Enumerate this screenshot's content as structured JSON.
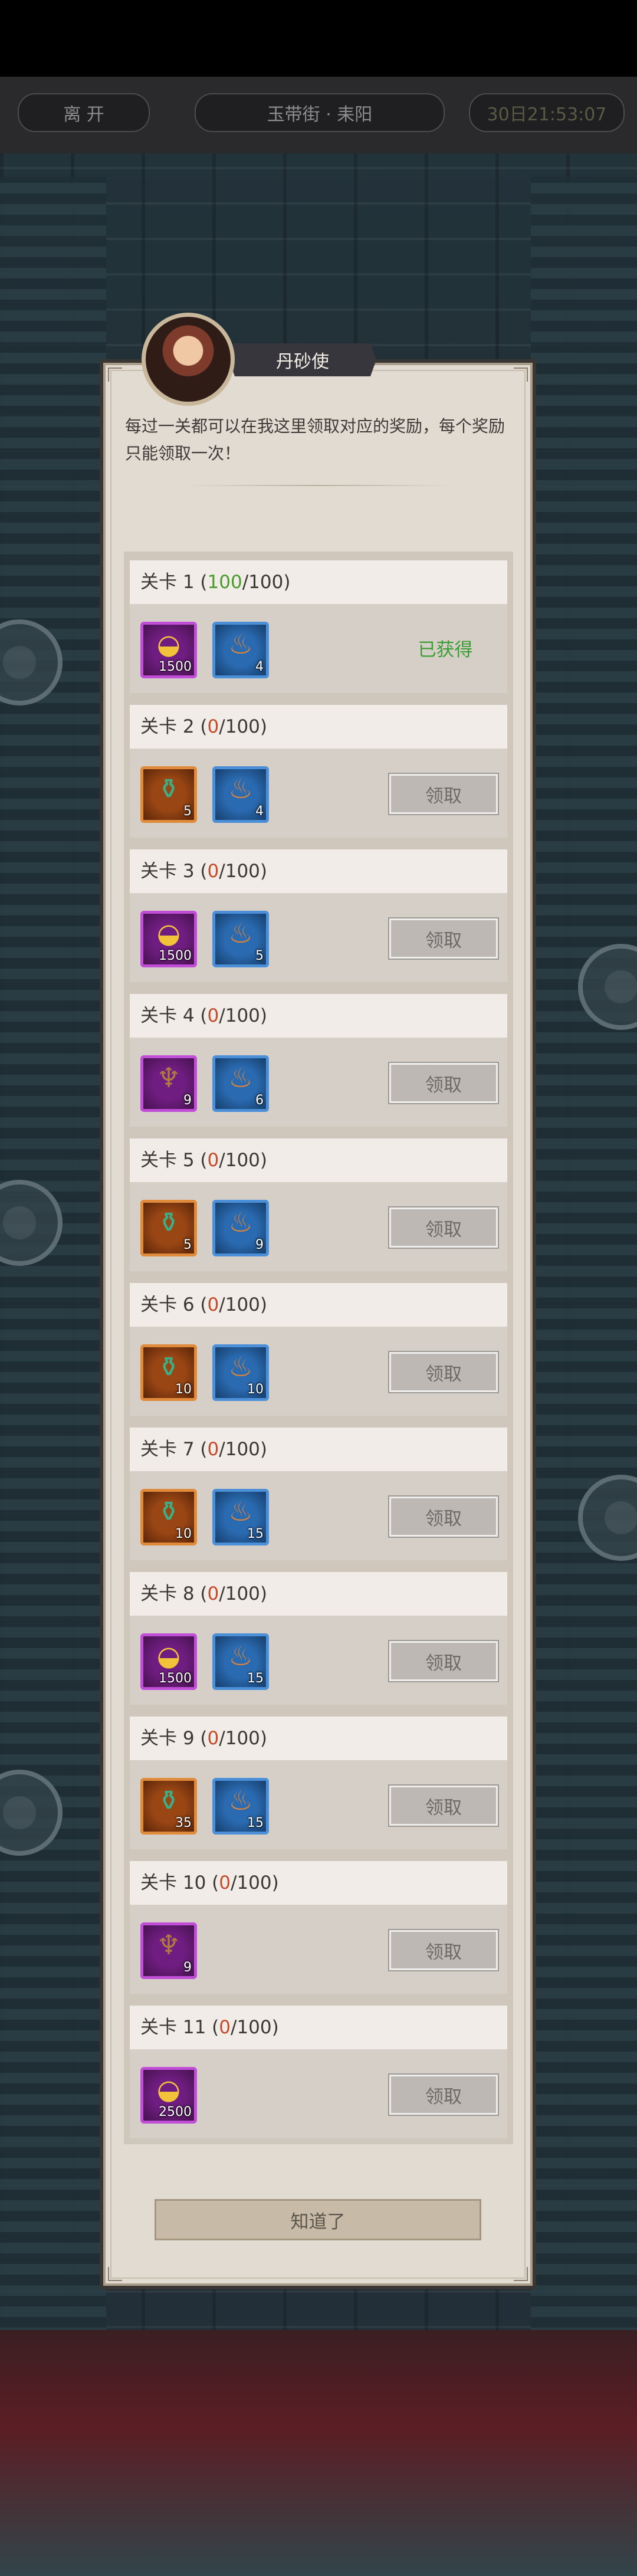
{
  "header": {
    "leave_label": "离 开",
    "location_label": "玉带街 · 耒阳",
    "timer_label": "30日21:53:07"
  },
  "npc": {
    "name": "丹砂使",
    "message": "每过一关都可以在我这里领取对应的奖励，每个奖励只能领取一次！"
  },
  "levels": [
    {
      "label": "关卡 1",
      "progress": "100",
      "total": "100",
      "status": "已获得",
      "rewards": [
        {
          "icon": "gold-ingot-icon",
          "color": "purple",
          "qty": "1500"
        },
        {
          "icon": "pouch-icon",
          "color": "blue",
          "qty": "4"
        }
      ]
    },
    {
      "label": "关卡 2",
      "progress": "0",
      "total": "100",
      "status": "领取",
      "rewards": [
        {
          "icon": "gourd-icon",
          "color": "orange",
          "qty": "5"
        },
        {
          "icon": "pouch-icon",
          "color": "blue",
          "qty": "4"
        }
      ]
    },
    {
      "label": "关卡 3",
      "progress": "0",
      "total": "100",
      "status": "领取",
      "rewards": [
        {
          "icon": "gold-ingot-icon",
          "color": "purple",
          "qty": "1500"
        },
        {
          "icon": "pouch-icon",
          "color": "blue",
          "qty": "5"
        }
      ]
    },
    {
      "label": "关卡 4",
      "progress": "0",
      "total": "100",
      "status": "领取",
      "rewards": [
        {
          "icon": "incense-burner-icon",
          "color": "purple",
          "qty": "9"
        },
        {
          "icon": "pouch-icon",
          "color": "blue",
          "qty": "6"
        }
      ]
    },
    {
      "label": "关卡 5",
      "progress": "0",
      "total": "100",
      "status": "领取",
      "rewards": [
        {
          "icon": "gourd-icon",
          "color": "orange",
          "qty": "5"
        },
        {
          "icon": "pouch-icon",
          "color": "blue",
          "qty": "9"
        }
      ]
    },
    {
      "label": "关卡 6",
      "progress": "0",
      "total": "100",
      "status": "领取",
      "rewards": [
        {
          "icon": "gourd-icon",
          "color": "orange",
          "qty": "10"
        },
        {
          "icon": "pouch-icon",
          "color": "blue",
          "qty": "10"
        }
      ]
    },
    {
      "label": "关卡 7",
      "progress": "0",
      "total": "100",
      "status": "领取",
      "rewards": [
        {
          "icon": "gourd-icon",
          "color": "orange",
          "qty": "10"
        },
        {
          "icon": "pouch-icon",
          "color": "blue",
          "qty": "15"
        }
      ]
    },
    {
      "label": "关卡 8",
      "progress": "0",
      "total": "100",
      "status": "领取",
      "rewards": [
        {
          "icon": "gold-ingot-icon",
          "color": "purple",
          "qty": "1500"
        },
        {
          "icon": "pouch-icon",
          "color": "blue",
          "qty": "15"
        }
      ]
    },
    {
      "label": "关卡 9",
      "progress": "0",
      "total": "100",
      "status": "领取",
      "rewards": [
        {
          "icon": "gourd-icon",
          "color": "orange",
          "qty": "35"
        },
        {
          "icon": "pouch-icon",
          "color": "blue",
          "qty": "15"
        }
      ]
    },
    {
      "label": "关卡 10",
      "progress": "0",
      "total": "100",
      "status": "领取",
      "rewards": [
        {
          "icon": "incense-burner-icon",
          "color": "purple",
          "qty": "9"
        }
      ]
    },
    {
      "label": "关卡 11",
      "progress": "0",
      "total": "100",
      "status": "领取",
      "rewards": [
        {
          "icon": "gold-ingot-icon",
          "color": "purple",
          "qty": "2500"
        }
      ]
    }
  ],
  "footer": {
    "ok_label": "知道了"
  }
}
